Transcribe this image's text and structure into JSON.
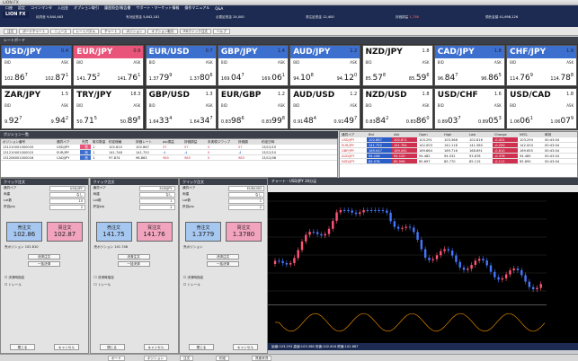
{
  "app": {
    "title": "LION FX",
    "menu": [
      "口座",
      "設定",
      "コインマンタ",
      "入出金",
      "オプション取引",
      "履歴照会/報告書",
      "サポート・マーケット情報",
      "操作マニュアル",
      "Q&A"
    ]
  },
  "account": [
    {
      "label": "純資産",
      "value": "9,840,463"
    },
    {
      "label": "有効証拠金",
      "value": "5,842,181"
    },
    {
      "label": "必要証拠金",
      "value": "24,000"
    },
    {
      "label": "発注証拠金",
      "value": "12,400"
    },
    {
      "label": "評価損益",
      "value": "1,738"
    },
    {
      "label": "預託金額",
      "value": "41,698,126"
    }
  ],
  "toolbar": [
    "注文",
    "ボードチャート",
    "ニュース",
    "レートパネル",
    "チャート",
    "ポジション",
    "オプション取引",
    "IFDクイック注文",
    "ヘルプ"
  ],
  "board_title": "レートボード",
  "tiles": [
    {
      "pair": "USD/JPY",
      "spread": "0.4",
      "bid_big": "102.",
      "bid_pip": "86",
      "bid_sub": "7",
      "ask_big": "102.",
      "ask_pip": "87",
      "ask_sub": "1",
      "style": "on"
    },
    {
      "pair": "EUR/JPY",
      "spread": "0.9",
      "bid_big": "141.",
      "bid_pip": "75",
      "bid_sub": "2",
      "ask_big": "141.",
      "ask_pip": "76",
      "ask_sub": "1",
      "style": "pink"
    },
    {
      "pair": "EUR/USD",
      "spread": "0.7",
      "bid_big": "1.37",
      "bid_pip": "79",
      "bid_sub": "9",
      "ask_big": "1.37",
      "ask_pip": "80",
      "ask_sub": "6",
      "style": "on"
    },
    {
      "pair": "GBP/JPY",
      "spread": "1.4",
      "bid_big": "169.",
      "bid_pip": "04",
      "bid_sub": "7",
      "ask_big": "169.",
      "ask_pip": "06",
      "ask_sub": "1",
      "style": "on"
    },
    {
      "pair": "AUD/JPY",
      "spread": "1.2",
      "bid_big": "94.",
      "bid_pip": "10",
      "bid_sub": "8",
      "ask_big": "94.",
      "ask_pip": "12",
      "ask_sub": "0",
      "style": "on"
    },
    {
      "pair": "NZD/JPY",
      "spread": "1.8",
      "bid_big": "85.",
      "bid_pip": "57",
      "bid_sub": "8",
      "ask_big": "85.",
      "ask_pip": "59",
      "ask_sub": "6",
      "style": ""
    },
    {
      "pair": "CAD/JPY",
      "spread": "1.8",
      "bid_big": "96.",
      "bid_pip": "84",
      "bid_sub": "7",
      "ask_big": "96.",
      "ask_pip": "86",
      "ask_sub": "5",
      "style": "on"
    },
    {
      "pair": "CHF/JPY",
      "spread": "1.9",
      "bid_big": "114.",
      "bid_pip": "76",
      "bid_sub": "9",
      "ask_big": "114.",
      "ask_pip": "78",
      "ask_sub": "8",
      "style": "on"
    },
    {
      "pair": "ZAR/JPY",
      "spread": "1.5",
      "bid_big": "9.",
      "bid_pip": "92",
      "bid_sub": "7",
      "ask_big": "9.",
      "ask_pip": "94",
      "ask_sub": "2",
      "style": ""
    },
    {
      "pair": "TRY/JPY",
      "spread": "18.3",
      "bid_big": "50.",
      "bid_pip": "71",
      "bid_sub": "5",
      "ask_big": "50.",
      "ask_pip": "89",
      "ask_sub": "8",
      "style": ""
    },
    {
      "pair": "GBP/USD",
      "spread": "1.3",
      "bid_big": "1.64",
      "bid_pip": "33",
      "bid_sub": "4",
      "ask_big": "1.64",
      "ask_pip": "34",
      "ask_sub": "7",
      "style": ""
    },
    {
      "pair": "EUR/GBP",
      "spread": "1.2",
      "bid_big": "0.83",
      "bid_pip": "98",
      "bid_sub": "6",
      "ask_big": "0.83",
      "ask_pip": "99",
      "ask_sub": "8",
      "style": ""
    },
    {
      "pair": "AUD/USD",
      "spread": "1.2",
      "bid_big": "0.91",
      "bid_pip": "48",
      "bid_sub": "4",
      "ask_big": "0.91",
      "ask_pip": "49",
      "ask_sub": "7",
      "style": ""
    },
    {
      "pair": "NZD/USD",
      "spread": "1.8",
      "bid_big": "0.83",
      "bid_pip": "84",
      "bid_sub": "2",
      "ask_big": "0.83",
      "ask_pip": "86",
      "ask_sub": "0",
      "style": ""
    },
    {
      "pair": "USD/CHF",
      "spread": "1.6",
      "bid_big": "0.89",
      "bid_pip": "03",
      "bid_sub": "7",
      "ask_big": "0.89",
      "ask_pip": "05",
      "ask_sub": "3",
      "style": ""
    },
    {
      "pair": "USD/CAD",
      "spread": "1.8",
      "bid_big": "1.06",
      "bid_pip": "06",
      "bid_sub": "1",
      "ask_big": "1.06",
      "ask_pip": "07",
      "ask_sub": "9",
      "style": ""
    }
  ],
  "positions": {
    "title": "ポジション一覧",
    "headers": [
      "ポジション番号",
      "通貨ペア",
      "売買",
      "取引数量",
      "約定価格",
      "評価レート",
      "pip損益",
      "評価損益",
      "未実現スワップ",
      "評価額",
      "約定日時"
    ],
    "rows": [
      [
        "131210001000033",
        "USD/JPY",
        "買",
        "1",
        "102.810",
        "102.867",
        "57",
        "57",
        "0",
        "57",
        "13/12/10"
      ],
      [
        "131210001000015",
        "EUR/JPY",
        "売",
        "1",
        "141.748",
        "141.752",
        "-4",
        "-4",
        "0",
        "-4",
        "13/12/10"
      ],
      [
        "131206001000016",
        "CAD/JPY",
        "売",
        "1",
        "97.874",
        "96.863",
        "985",
        "985",
        "0",
        "985",
        "13/12/06"
      ]
    ]
  },
  "rate_table": {
    "headers": [
      "通貨ペア",
      "Bid",
      "Ask",
      "Open",
      "High",
      "Low",
      "Change",
      "NYCL",
      "時刻"
    ],
    "rows": [
      [
        "USD/JPY",
        "102.867",
        "102.871",
        "103.291",
        "103.368",
        "102.816",
        "-0.431",
        "103.294",
        "00:43:04"
      ],
      [
        "EUR/JPY",
        "141.752",
        "141.761",
        "142.003",
        "142.118",
        "141.580",
        "-0.250",
        "142.004",
        "00:43:04"
      ],
      [
        "GBP/JPY",
        "169.047",
        "169.061",
        "169.664",
        "169.716",
        "168.691",
        "-0.610",
        "169.655",
        "00:43:04"
      ],
      [
        "AUD/JPY",
        "94.108",
        "94.120",
        "94.482",
        "94.532",
        "93.678",
        "-0.376",
        "94.485",
        "00:43:04"
      ],
      [
        "NZD/JPY",
        "85.578",
        "85.596",
        "85.697",
        "85.770",
        "85.115",
        "-0.111",
        "85.690",
        "00:43:04"
      ]
    ]
  },
  "panels": [
    {
      "title": "クイック注文",
      "pair": "USD/JPY",
      "mode": "なし",
      "qty": "10",
      "slip": "2",
      "sell_price": "102.86",
      "sell_sub": "7",
      "buy_price": "102.87",
      "buy_sub": "1",
      "position": "102.810"
    },
    {
      "title": "クイック注文",
      "pair": "EUR/JPY",
      "mode": "なし",
      "qty": "1",
      "slip": "2",
      "sell_price": "141.75",
      "sell_sub": "2",
      "buy_price": "141.76",
      "buy_sub": "1",
      "position": "141.748"
    },
    {
      "title": "クイック注文",
      "pair": "EUR/USD",
      "mode": "なし",
      "qty": "1",
      "slip": "2",
      "sell_price": "1.3779",
      "sell_sub": "9",
      "buy_price": "1.3780",
      "buy_sub": "6",
      "position": ""
    }
  ],
  "panel_labels": {
    "pair": "通貨ペア",
    "mode": "両建",
    "qty": "Lot数",
    "slip": "許容pip",
    "sell": "売注文",
    "buy": "買注文",
    "pos": "売ポジション",
    "settle": "決済注文",
    "all": "一括決済",
    "chk1": "決済時指定",
    "chk2": "トレール",
    "close": "閉じる",
    "cancel": "キャンセル"
  },
  "chart": {
    "title": "チャート - USD/JPY 30分足",
    "status": "始値:103.293 高値:103.368 安値:102.816 終値:102.867"
  },
  "footer": {
    "tabs": [
      "ボード",
      "ポジション",
      "注文",
      "約定",
      "資産状況"
    ]
  }
}
